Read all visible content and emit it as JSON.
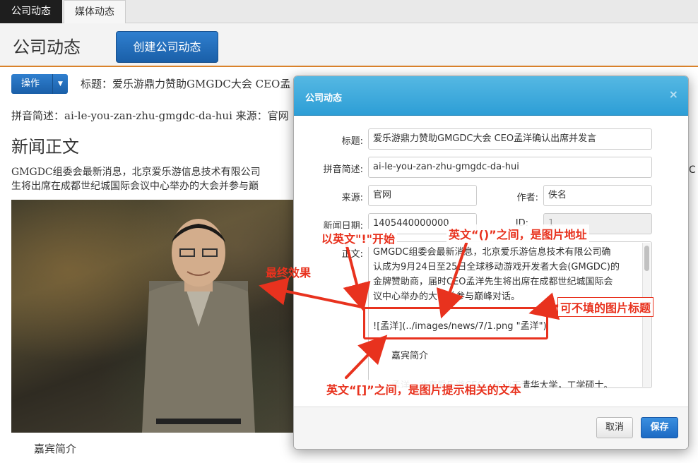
{
  "tabs": [
    {
      "label": "公司动态",
      "active": true
    },
    {
      "label": "媒体动态",
      "active": false
    }
  ],
  "header": {
    "title": "公司动态",
    "create_button": "创建公司动态"
  },
  "content": {
    "ops_button": "操作",
    "title_line": "标题：爱乐游鼎力赞助GMGDC大会 CEO孟",
    "pinyin_line": "拼音简述：ai-le-you-zan-zhu-gmgdc-da-hui 来源：官网",
    "news_heading": "新闻正文",
    "body_line1": "GMGDC组委会最新消息，北京爱乐游信息技术有限公司",
    "body_line2": "生将出席在成都世纪城国际会议中心举办的大会并参与巅",
    "body_right1": "C",
    "body_right2": "",
    "guest_intro": "嘉宾简介"
  },
  "modal": {
    "title": "公司动态",
    "close": "×",
    "fields": {
      "title_label": "标题:",
      "title_value": "爱乐游鼎力赞助GMGDC大会 CEO孟洋确认出席并发言",
      "pinyin_label": "拼音简述:",
      "pinyin_value": "ai-le-you-zan-zhu-gmgdc-da-hui",
      "source_label": "来源:",
      "source_value": "官网",
      "author_label": "作者:",
      "author_value": "佚名",
      "date_label": "新闻日期:",
      "date_value": "1405440000000",
      "id_label": "ID:",
      "id_value": "1",
      "body_label": "正文:"
    },
    "body_lines": [
      "GMGDC组委会最新消息，北京爱乐游信息技术有限公司确",
      "认成为9月24日至25日全球移动游戏开发者大会(GMGDC)的",
      "金牌赞助商，届时CEO孟洋先生将出席在成都世纪城国际会",
      "议中心举办的大会并参与巅峰对话。",
      "",
      "![孟洋](../images/news/7/1.png \"孟洋\")",
      "",
      "　　嘉宾简介",
      "",
      "　　孟洋，北京爱乐游CEO。毕业于清华大学，工学硕士。"
    ],
    "cancel": "取消",
    "save": "保存"
  },
  "annotations": {
    "final_effect": "最终效果",
    "starts_with": "以英文\"!\"开始",
    "paren_note": "英文“()”之间，是图片地址",
    "optional_title": "可不填的图片标题",
    "bracket_note": "英文“[]”之间，是图片提示相关的文本"
  },
  "colors": {
    "annotation_red": "#e8321e",
    "modal_header_blue": "#2d9ed6",
    "primary_blue": "#1c6ac4",
    "header_accent": "#d9822b"
  }
}
